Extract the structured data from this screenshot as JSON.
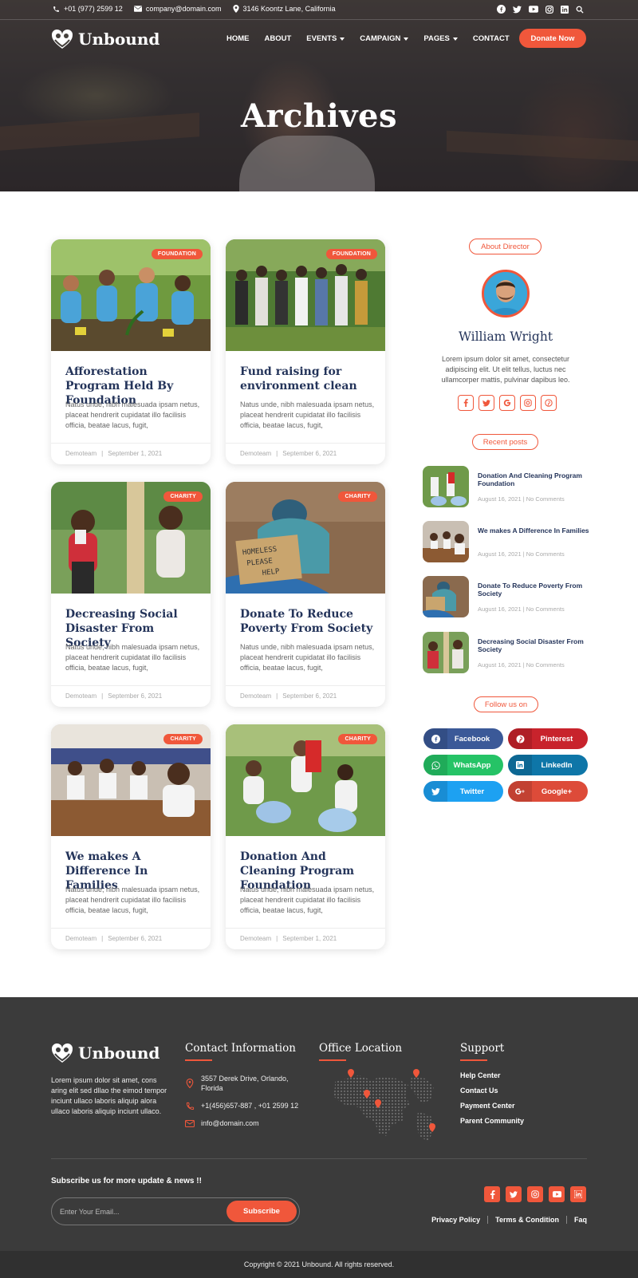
{
  "topbar": {
    "phone": "+01 (977) 2599 12",
    "email": "company@domain.com",
    "address": "3146 Koontz Lane, California",
    "social_icons": [
      "facebook-icon",
      "twitter-icon",
      "youtube-icon",
      "instagram-icon",
      "linkedin-icon",
      "search-icon"
    ]
  },
  "brand": {
    "name": "Unbound"
  },
  "nav": {
    "items": [
      "HOME",
      "ABOUT",
      "EVENTS",
      "CAMPAIGN",
      "PAGES",
      "CONTACT"
    ],
    "donate_label": "Donate Now"
  },
  "hero": {
    "title": "Archives"
  },
  "posts": [
    {
      "category": "FOUNDATION",
      "title": "Afforestation Program Held By Foundation",
      "excerpt": "Natus unde, nibh malesuada ipsam netus, placeat hendrerit cupidatat illo facilisis officia, beatae lacus, fugit,",
      "author": "Demoteam",
      "date": "September 1, 2021"
    },
    {
      "category": "FOUNDATION",
      "title": "Fund raising for environment clean",
      "excerpt": "Natus unde, nibh malesuada ipsam netus, placeat hendrerit cupidatat illo facilisis officia, beatae lacus, fugit,",
      "author": "Demoteam",
      "date": "September 6, 2021"
    },
    {
      "category": "CHARITY",
      "title": "Decreasing Social Disaster From Society",
      "excerpt": "Natus unde, nibh malesuada ipsam netus, placeat hendrerit cupidatat illo facilisis officia, beatae lacus, fugit,",
      "author": "Demoteam",
      "date": "September 6, 2021"
    },
    {
      "category": "CHARITY",
      "title": "Donate To Reduce Poverty From Society",
      "excerpt": "Natus unde, nibh malesuada ipsam netus, placeat hendrerit cupidatat illo facilisis officia, beatae lacus, fugit,",
      "author": "Demoteam",
      "date": "September 6, 2021"
    },
    {
      "category": "CHARITY",
      "title": "We makes A Difference In Families",
      "excerpt": "Natus unde, nibh malesuada ipsam netus, placeat hendrerit cupidatat illo facilisis officia, beatae lacus, fugit,",
      "author": "Demoteam",
      "date": "September 6, 2021"
    },
    {
      "category": "CHARITY",
      "title": "Donation And Cleaning Program Foundation",
      "excerpt": "Natus unde, nibh malesuada ipsam netus, placeat hendrerit cupidatat illo facilisis officia, beatae lacus, fugit,",
      "author": "Demoteam",
      "date": "September 1, 2021"
    }
  ],
  "sidebar": {
    "about_heading": "About Director",
    "director_name": "William Wright",
    "director_bio": "Lorem ipsum dolor sit amet, consectetur adipiscing elit. Ut elit tellus, luctus nec ullamcorper mattis, pulvinar dapibus leo.",
    "director_social_icons": [
      "facebook-icon",
      "twitter-icon",
      "google-icon",
      "instagram-icon",
      "pinterest-icon"
    ],
    "recent_heading": "Recent posts",
    "recent_posts": [
      {
        "title": "Donation And Cleaning Program Foundation",
        "date": "August 16, 2021",
        "comments": "No Comments"
      },
      {
        "title": "We makes A Difference In Families",
        "date": "August 16, 2021",
        "comments": "No Comments"
      },
      {
        "title": "Donate To Reduce Poverty From Society",
        "date": "August 16, 2021",
        "comments": "No Comments"
      },
      {
        "title": "Decreasing Social Disaster From Society",
        "date": "August 16, 2021",
        "comments": "No Comments"
      }
    ],
    "follow_heading": "Follow us on",
    "follow_buttons": [
      {
        "label": "Facebook",
        "color": "#3b5998",
        "icon": "facebook-icon"
      },
      {
        "label": "Pinterest",
        "color": "#c8232c",
        "icon": "pinterest-icon"
      },
      {
        "label": "WhatsApp",
        "color": "#25c366",
        "icon": "whatsapp-icon"
      },
      {
        "label": "LinkedIn",
        "color": "#0e76a8",
        "icon": "linkedin-icon"
      },
      {
        "label": "Twitter",
        "color": "#1da1f2",
        "icon": "twitter-icon"
      },
      {
        "label": "Google+",
        "color": "#dd4b39",
        "icon": "google-plus-icon"
      }
    ]
  },
  "footer": {
    "about": "Lorem ipsum dolor sit amet, cons aring elit sed dllao the eimod tempor inciunt ullaco laboris aliquip alora ullaco laboris aliquip inciunt ullaco.",
    "contact_heading": "Contact Information",
    "contact_address": "3557 Derek Drive, Orlando, Florida",
    "contact_phone": "+1(456)657-887 , +01 2599 12",
    "contact_email": "info@domain.com",
    "office_heading": "Office Location",
    "support_heading": "Support",
    "support_links": [
      "Help Center",
      "Contact Us",
      "Payment Center",
      "Parent Community"
    ],
    "subscribe_heading": "Subscribe us for more update & news !!",
    "subscribe_placeholder": "Enter Your Email...",
    "subscribe_button": "Subscribe",
    "social_icons": [
      "facebook-icon",
      "twitter-icon",
      "instagram-icon",
      "youtube-icon",
      "linkedin-icon"
    ],
    "bottom_links": [
      "Privacy Policy",
      "Terms & Condition",
      "Faq"
    ],
    "copyright": "Copyright © 2021 Unbound. All rights reserved."
  },
  "colors": {
    "accent": "#f0573b",
    "heading": "#24345a",
    "footer_bg": "#3b3b3b"
  }
}
